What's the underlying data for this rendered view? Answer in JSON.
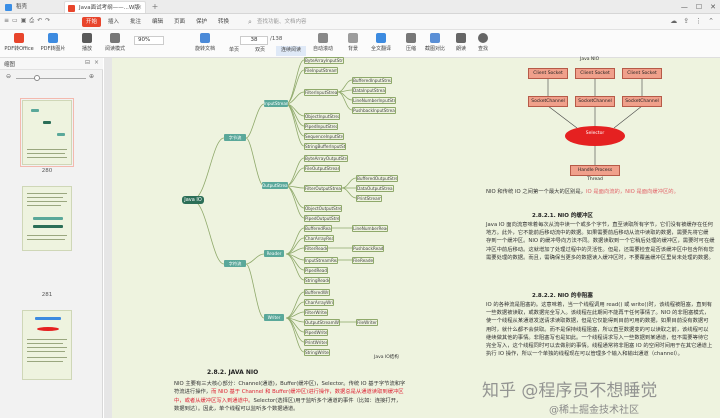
{
  "titlebar": {
    "tabs": [
      {
        "label": "稻壳"
      },
      {
        "label": "Java面试考纲——...W版本.pdf"
      }
    ]
  },
  "menubar": {
    "items": [
      "开始",
      "插入",
      "批注",
      "编辑",
      "页面",
      "保护",
      "转换"
    ],
    "active": "开始",
    "search_placeholder": "查找功能、文档内容"
  },
  "toolbar": {
    "tools": [
      "PDF转Office",
      "PDF转图片",
      "播放",
      "阅读模式",
      "旋转文档",
      "单页",
      "双页",
      "连续阅读",
      "自动滚动",
      "背景",
      "全文翻译",
      "压缩",
      "截图对比",
      "朗读",
      "查找"
    ],
    "zoom": "90%",
    "page_current": "38",
    "page_total": "/138"
  },
  "leftpanel": {
    "title": "缩图",
    "thumb_labels": [
      "280",
      "281"
    ]
  },
  "mindmap": {
    "root": "Java IO",
    "l1": [
      "字节流",
      "字符流"
    ],
    "l2": [
      "InputStream",
      "OutputStream",
      "Reader",
      "Writer"
    ],
    "l3_in": [
      "ByteArrayInputStream",
      "FileInputStream",
      "FilterInputStream",
      "ObjectInputStream",
      "PipedInputStream",
      "SequenceInputStream",
      "StringBufferInputStream"
    ],
    "l4_in": [
      "BufferedInputStream",
      "DataInputStream",
      "LineNumberInputStream",
      "PushbackInputStream"
    ],
    "l3_out": [
      "ByteArrayOutputStream",
      "FileOutputStream",
      "FilterOutputStream",
      "ObjectOutputStream",
      "PipedOutputStream"
    ],
    "l4_out": [
      "BufferedOutputStream",
      "DataOutputStream",
      "PrintStream"
    ],
    "l3_reader": [
      "BufferedReader",
      "CharArrayReader",
      "FilterReader",
      "InputStreamReader",
      "PipedReader",
      "StringReader"
    ],
    "l4_reader": [
      "LineNumberReader",
      "PushbackReader",
      "FileReader"
    ],
    "l3_writer": [
      "BufferedWriter",
      "CharArrayWriter",
      "FilterWriter",
      "OutputStreamWriter",
      "PipedWriter",
      "PrintWriter",
      "StringWriter"
    ],
    "l4_writer": [
      "FileWriter"
    ],
    "caption": "Java IO结构"
  },
  "left_text": {
    "section": "2.8.2.  JAVA NIO",
    "p1_a": "NIO 主要有三大核心部分：Channel(通道)，Buffer(缓冲区)，Selector。传统 IO 基于字节流和字",
    "p1_b": "符流进行操作，",
    "p1_red": "而 NIO 基于 Channel 和 Buffer(缓冲区)进行操作，数据总是从通道读取到缓冲区",
    "p1_red2": "中，或者从缓冲区写入到通道中。",
    "p1_c": "Selector(选择区)用于监听多个通道的事件（比如：连接打开，",
    "p1_d": "数据到达）。因此，单个线程可以监听多个数据通道。"
  },
  "right_diagram": {
    "title": "Java NIO",
    "sockets": [
      "Client Socket",
      "Client Socket",
      "Client Socket"
    ],
    "channels": [
      "SocketChannel",
      "SocketChannel",
      "SocketChannel"
    ],
    "selector": "Selector",
    "thread": "Handle Process Thread"
  },
  "right_text": {
    "p0": "NIO 和传统 IO 之间第一个最大的区别是，",
    "p0_red": "IO 是面向流的，NIO 是面向缓冲区的。",
    "s1": "2.8.2.1.    NIO 的缓冲区",
    "p1": [
      "Java IO 面向流意味着每次从流中读一个或多个字节，直至读取所有字节，它们没有被缓存在任何",
      "地方。此外，它不能前后移动流中的数据。如果需要前后移动从流中读取的数据，需要先将它缓",
      "存到一个缓冲区。NIO 的缓冲导向方法不同。数据读取到一个它稍后处理的缓冲区，需要时可在缓",
      "冲区中前后移动。这就增加了处理过程中的灵活性。但是，还需要检查是否该缓冲区中包含所有您",
      "需要处理的数据。而且，需确保当更多的数据读入缓冲区时，不要覆盖缓冲区里尚未处理的数据。"
    ],
    "s2": "2.8.2.2.    NIO 的非阻塞",
    "p2": [
      "IO 的各种流是阻塞的。这意味着，当一个线程调用 read() 或 write()时，该线程被阻塞，直到有",
      "一些数据被读取，或数据完全写入。该线程在此期间不能再干任何事情了。NIO 的非阻塞模式，",
      "使一个线程从某通道发送请求读取数据，但是它仅能得到目前可用的数据，如果目前没有数据可",
      "用时，就什么都不会获取。而不是保持线程阻塞，所以直至数据变的可以读取之前，该线程可以",
      "继续做其他的事情。非阻塞写也是如此。一个线程请求写入一些数据到某通道，但不需要等待它",
      "完全写入，这个线程同时可以去做别的事情。线程通常将非阻塞 IO 的空闲时间用于在其它通道上",
      "执行 IO 操作，所以一个单独的线程现在可以管理多个输入和输出通道（channel）。"
    ]
  },
  "watermark": {
    "main": "知乎 @程序员不想睡觉",
    "sub": "@稀土掘金技术社区"
  }
}
